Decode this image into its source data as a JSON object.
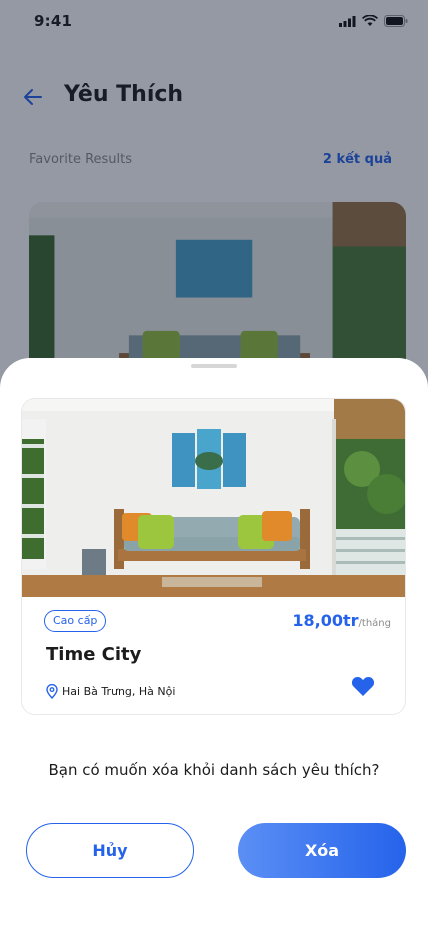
{
  "status_bar": {
    "time": "9:41"
  },
  "header": {
    "title": "Yêu Thích"
  },
  "results": {
    "label": "Favorite Results",
    "count": "2 kết quả"
  },
  "card": {
    "badge": "Cao cấp",
    "price": "18,00tr",
    "price_unit": "/tháng",
    "title": "Time City",
    "location": "Hai Bà Trưng, Hà Nội",
    "favorited": true
  },
  "dialog": {
    "question": "Bạn có muốn xóa khỏi danh sách yêu thích?",
    "cancel_label": "Hủy",
    "delete_label": "Xóa"
  },
  "colors": {
    "accent": "#2563eb",
    "overlay": "#121c34"
  }
}
